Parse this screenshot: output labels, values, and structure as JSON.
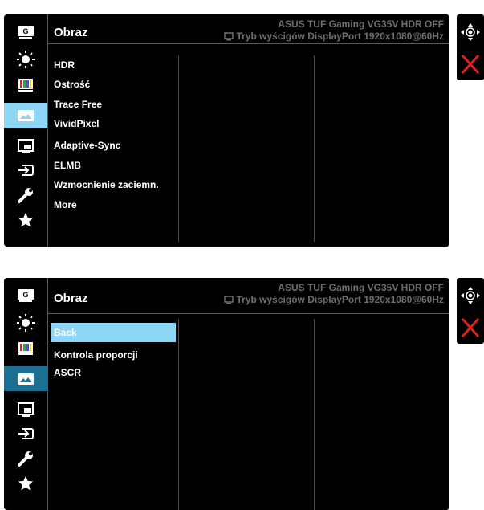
{
  "osd_top": {
    "title": "Obraz",
    "model_info": "ASUS TUF Gaming VG35V HDR OFF",
    "mode_info": "Tryb wyścigów DisplayPort 1920x1080@60Hz",
    "menu_items": [
      "HDR",
      "Ostrość",
      "Trace Free",
      "VividPixel",
      "Adaptive-Sync",
      "ELMB",
      "Wzmocnienie zaciemn.",
      "More"
    ]
  },
  "osd_bottom": {
    "title": "Obraz",
    "model_info": "ASUS TUF Gaming VG35V HDR OFF",
    "mode_info": "Tryb wyścigów DisplayPort 1920x1080@60Hz",
    "menu_items": [
      "Back",
      "Kontrola proporcji",
      "ASCR"
    ]
  },
  "sidebar_icons": [
    "gameplus-icon",
    "brightness-icon",
    "color-icon",
    "image-icon",
    "pip-icon",
    "input-icon",
    "wrench-icon",
    "star-icon"
  ],
  "selected_sidebar": "image-icon",
  "nav_icons": [
    "move-icon",
    "close-icon"
  ],
  "colors": {
    "highlight": "#8ed6f5",
    "selected_dark": "#1b6f92",
    "close": "#e0201b",
    "background": "#000000"
  }
}
